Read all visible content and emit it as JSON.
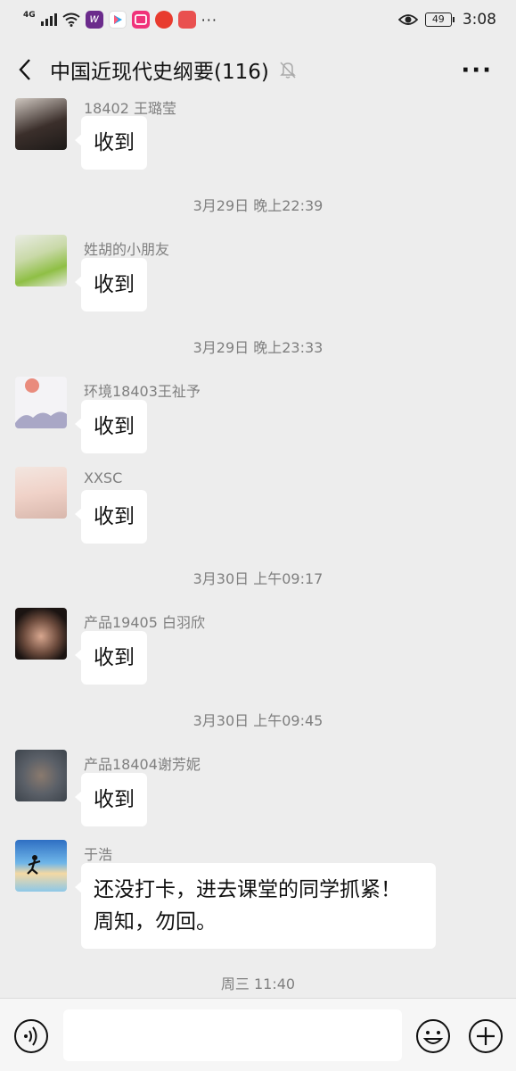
{
  "status_bar": {
    "network": "4G",
    "battery": "49",
    "time": "3:08",
    "overflow": "···"
  },
  "header": {
    "title": "中国近现代史纲要(116)",
    "more": "···"
  },
  "messages": [
    {
      "type": "message",
      "sender": "18402 王璐莹",
      "text": "收到"
    },
    {
      "type": "time",
      "text": "3月29日 晚上22:39"
    },
    {
      "type": "message",
      "sender": "姓胡的小朋友",
      "text": "收到"
    },
    {
      "type": "time",
      "text": "3月29日 晚上23:33"
    },
    {
      "type": "message",
      "sender": "环境18403王祉予",
      "text": "收到"
    },
    {
      "type": "message",
      "sender": "XXSC",
      "text": "收到"
    },
    {
      "type": "time",
      "text": "3月30日 上午09:17"
    },
    {
      "type": "message",
      "sender": "产品19405 白羽欣",
      "text": "收到"
    },
    {
      "type": "time",
      "text": "3月30日 上午09:45"
    },
    {
      "type": "message",
      "sender": "产品18404谢芳妮",
      "text": "收到"
    },
    {
      "type": "message",
      "sender": "于浩",
      "text_line1": "还没打卡，进去课堂的同学抓紧！",
      "text_line2": "周知，勿回。"
    },
    {
      "type": "time",
      "text": "周三 11:40"
    }
  ],
  "colors": {
    "background": "#ededed",
    "bubble": "#ffffff",
    "meta_text": "#7f7f7f"
  },
  "icons": {
    "back": "chevron-left-icon",
    "mute": "bell-off-icon",
    "voice": "voice-icon",
    "emoji": "emoji-icon",
    "plus": "plus-circle-icon"
  }
}
